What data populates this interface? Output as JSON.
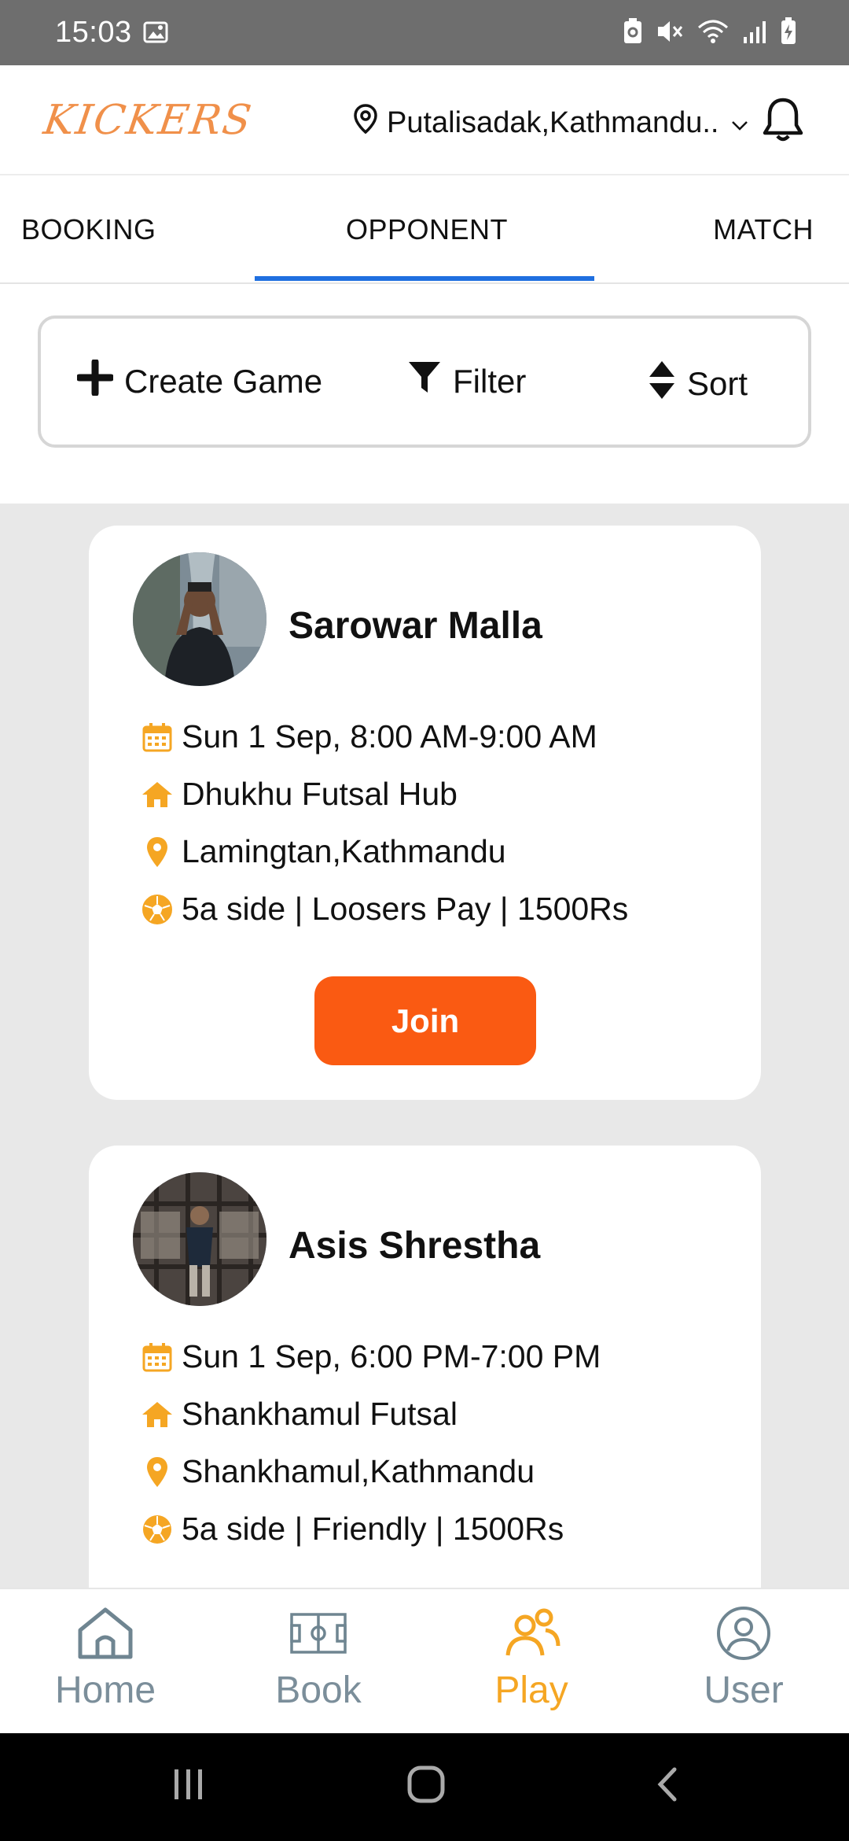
{
  "status_bar": {
    "time": "15:03"
  },
  "header": {
    "logo": "KICKERS",
    "location": "Putalisadak,Kathmandu.."
  },
  "tabs": [
    {
      "label": "BOOKING",
      "active": false
    },
    {
      "label": "OPPONENT",
      "active": true
    },
    {
      "label": "MATCH",
      "active": false
    }
  ],
  "toolbar": {
    "create_label": "Create Game",
    "filter_label": "Filter",
    "sort_label": "Sort"
  },
  "cards": [
    {
      "name": "Sarowar Malla",
      "datetime": "Sun 1 Sep, 8:00 AM-9:00 AM",
      "venue": "Dhukhu Futsal Hub",
      "address": "Lamingtan,Kathmandu",
      "details": "5a side | Loosers Pay | 1500Rs",
      "join_label": "Join"
    },
    {
      "name": "Asis Shrestha",
      "datetime": "Sun 1 Sep, 6:00 PM-7:00 PM",
      "venue": "Shankhamul Futsal",
      "address": "Shankhamul,Kathmandu",
      "details": "5a side | Friendly | 1500Rs"
    }
  ],
  "bottom_nav": [
    {
      "label": "Home",
      "icon": "home-icon",
      "active": false
    },
    {
      "label": "Book",
      "icon": "field-icon",
      "active": false
    },
    {
      "label": "Play",
      "icon": "people-icon",
      "active": true
    },
    {
      "label": "User",
      "icon": "user-icon",
      "active": false
    }
  ],
  "colors": {
    "accent_orange": "#fa5a12",
    "icon_amber": "#f5a623",
    "tab_indicator": "#1f6fe0",
    "logo": "#f0904a"
  }
}
